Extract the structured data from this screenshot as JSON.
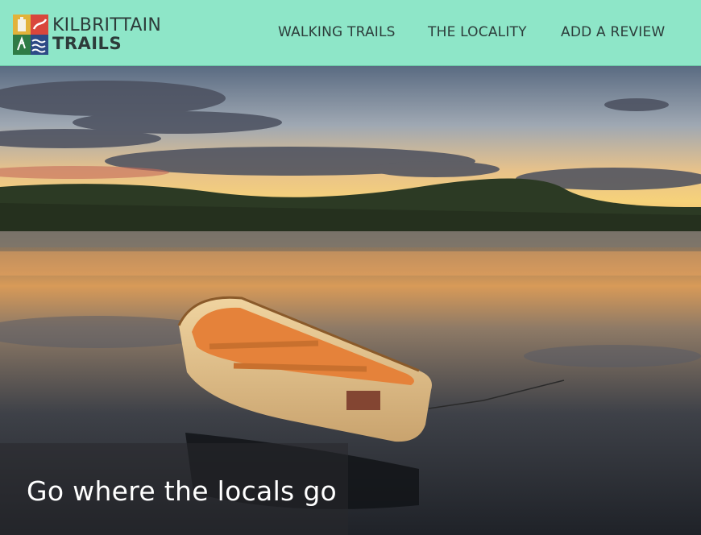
{
  "brand": {
    "line1": "KILBRITTAIN",
    "line2": "TRAILS",
    "colors": {
      "red": "#d9463c",
      "green": "#2f7b46",
      "blue": "#2d4a86",
      "gold": "#e2b23a"
    }
  },
  "nav": {
    "items": [
      {
        "label": "WALKING TRAILS"
      },
      {
        "label": "THE LOCALITY"
      },
      {
        "label": "ADD A REVIEW"
      }
    ]
  },
  "header": {
    "background": "#8ee6c8"
  },
  "hero": {
    "image": "sunset-estuary-rowboat",
    "headline": "Go where the locals go"
  }
}
